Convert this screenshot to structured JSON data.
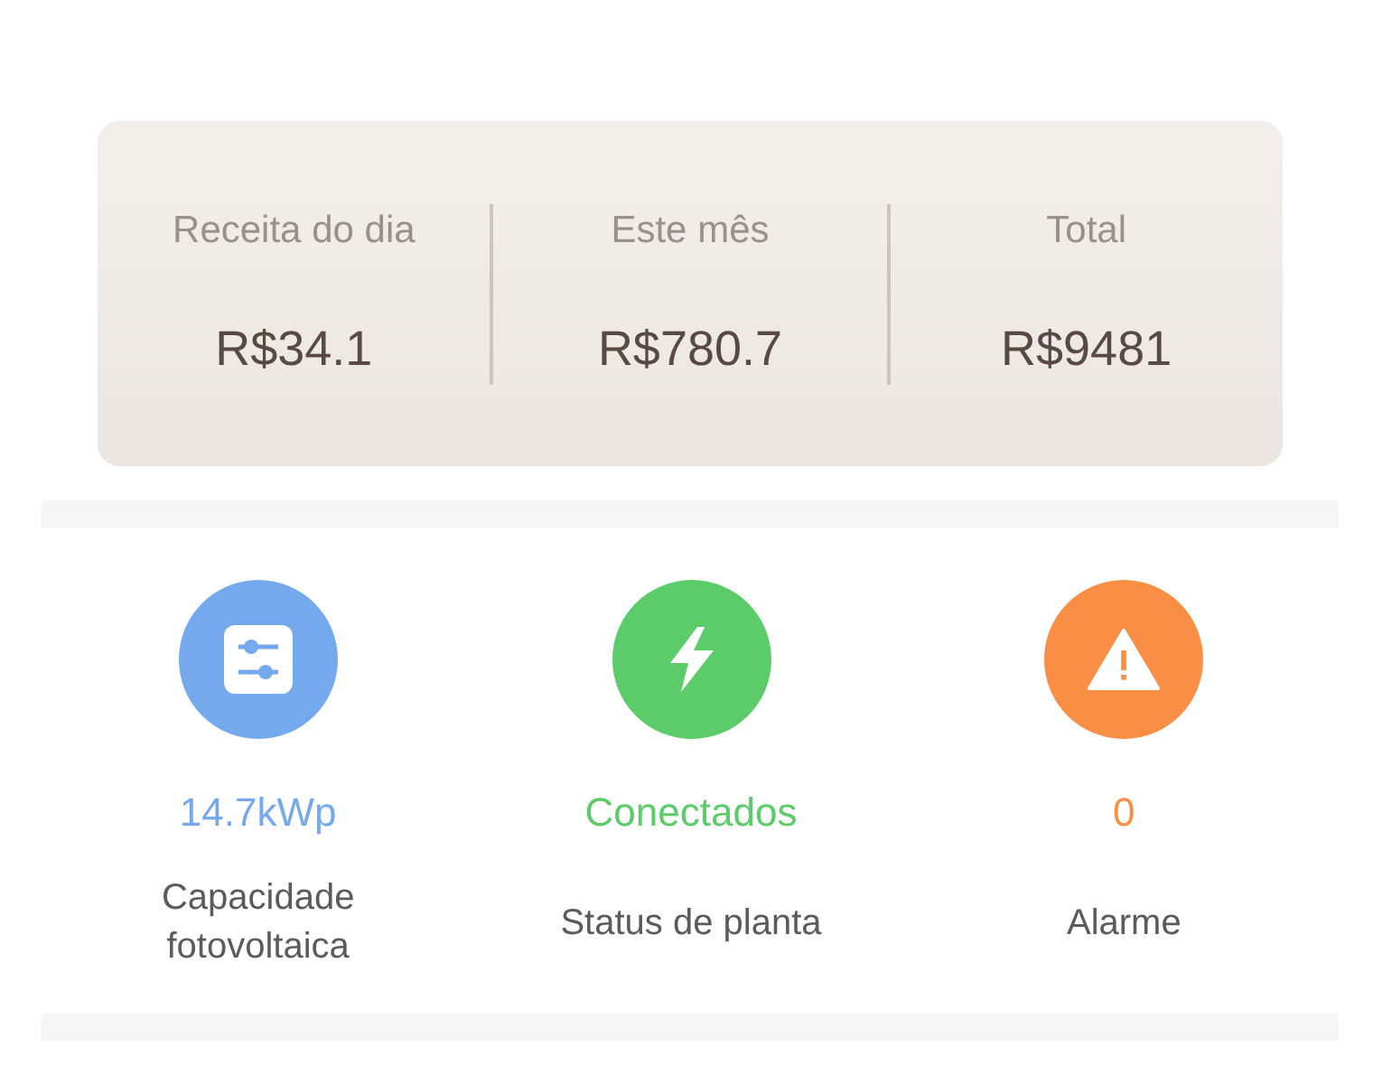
{
  "revenue": [
    {
      "label": "Receita do dia",
      "value": "R$34.1"
    },
    {
      "label": "Este mês",
      "value": "R$780.7"
    },
    {
      "label": "Total",
      "value": "R$9481"
    }
  ],
  "stats": [
    {
      "kind": "capacity",
      "color": "#74a9ee",
      "value": "14.7kWp",
      "label": "Capacidade fotovoltaica"
    },
    {
      "kind": "status",
      "color": "#5ccc6a",
      "value": "Conectados",
      "label": "Status de planta"
    },
    {
      "kind": "alarm",
      "color": "#fb8e45",
      "value": "0",
      "label": "Alarme"
    }
  ]
}
